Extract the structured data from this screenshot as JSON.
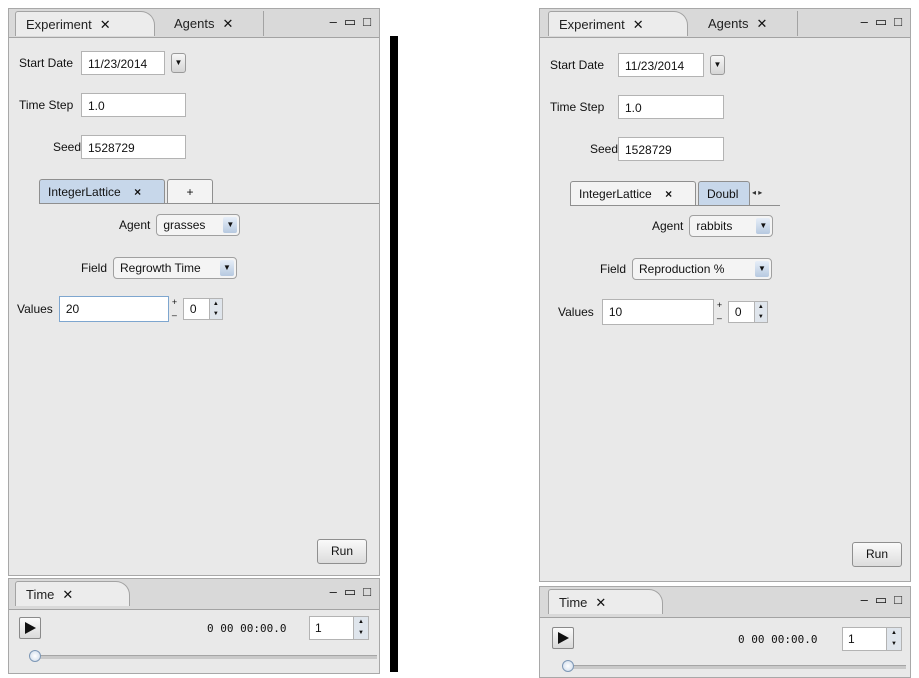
{
  "panels": [
    {
      "tabs": {
        "experiment": "Experiment",
        "agents": "Agents",
        "close": "✕"
      },
      "start_date": {
        "label": "Start Date",
        "value": "11/23/2014"
      },
      "time_step": {
        "label": "Time Step",
        "value": "1.0"
      },
      "seed": {
        "label": "Seed",
        "value": "1528729"
      },
      "subtabs": {
        "first": "IntegerLattice",
        "first_close": "×",
        "second": "+"
      },
      "agent": {
        "label": "Agent",
        "value": "grasses"
      },
      "field": {
        "label": "Field",
        "value": "Regrowth Time"
      },
      "values": {
        "label": "Values",
        "value": "20",
        "plus": "+",
        "minus": "–",
        "spinner": "0"
      },
      "run": "Run",
      "time": {
        "tab": "Time",
        "readout": "0 00 00:00.0",
        "spinner": "1"
      }
    },
    {
      "tabs": {
        "experiment": "Experiment",
        "agents": "Agents",
        "close": "✕"
      },
      "start_date": {
        "label": "Start Date",
        "value": "11/23/2014"
      },
      "time_step": {
        "label": "Time Step",
        "value": "1.0"
      },
      "seed": {
        "label": "Seed",
        "value": "1528729"
      },
      "subtabs": {
        "first": "IntegerLattice",
        "first_close": "×",
        "second": "Doubl"
      },
      "agent": {
        "label": "Agent",
        "value": "rabbits"
      },
      "field": {
        "label": "Field",
        "value": "Reproduction %"
      },
      "values": {
        "label": "Values",
        "value": "10",
        "plus": "+",
        "minus": "–",
        "spinner": "0"
      },
      "run": "Run",
      "time": {
        "tab": "Time",
        "readout": "0 00 00:00.0",
        "spinner": "1"
      }
    }
  ]
}
